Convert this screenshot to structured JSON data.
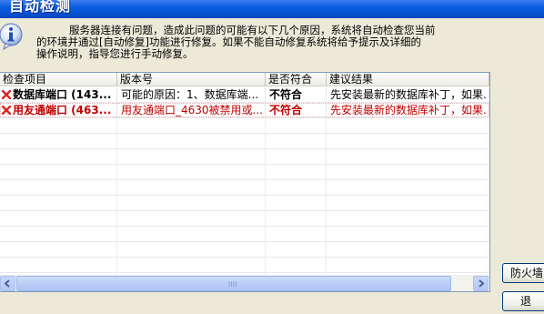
{
  "window": {
    "title": "自动检测"
  },
  "message": {
    "line1": "服务器连接有问题，造成此问题的可能有以下几个原因，系统将自动检查您当前",
    "line2": "的环境并通过[自动修复]功能进行修复。如果不能自动修复系统将给予提示及详细的",
    "line3": "操作说明，指导您进行手动修复。"
  },
  "table": {
    "columns": [
      "检查项目",
      "版本号",
      "是否符合",
      "建议结果"
    ],
    "rows": [
      {
        "status_icon": "error-x-icon",
        "item": "数据库端口 (143...",
        "version": "可能的原因：1、数据库端...",
        "match": "不符合",
        "suggestion": "先安装最新的数据库补丁，如果."
      },
      {
        "status_icon": "error-x-icon",
        "item": "用友通端口 (463...",
        "version": "用友通端口_4630被禁用或...",
        "match": "不符合",
        "suggestion": "先安装最新的数据库补丁，如果."
      }
    ]
  },
  "buttons": {
    "firewall": "防火墙",
    "exit": "退"
  },
  "colors": {
    "error_text": "#C00000",
    "titlebar": "#0A5DE0",
    "window_bg": "#ECE9D8"
  }
}
